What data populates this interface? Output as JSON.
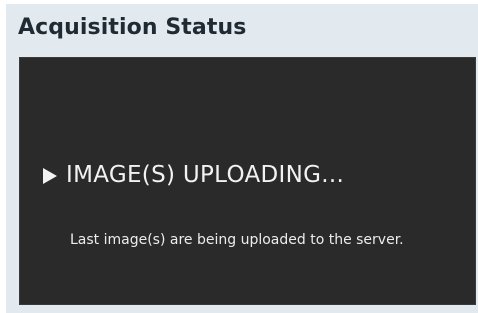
{
  "panel": {
    "title": "Acquisition Status"
  },
  "status": {
    "icon": "play-icon",
    "heading": "IMAGE(S) UPLOADING...",
    "message": "Last image(s) are being uploaded to the server."
  },
  "colors": {
    "panel_background": "#e2e9ef",
    "status_background": "#2a2a2a",
    "status_text": "#f2f2f2",
    "title_text": "#1f2a33"
  }
}
